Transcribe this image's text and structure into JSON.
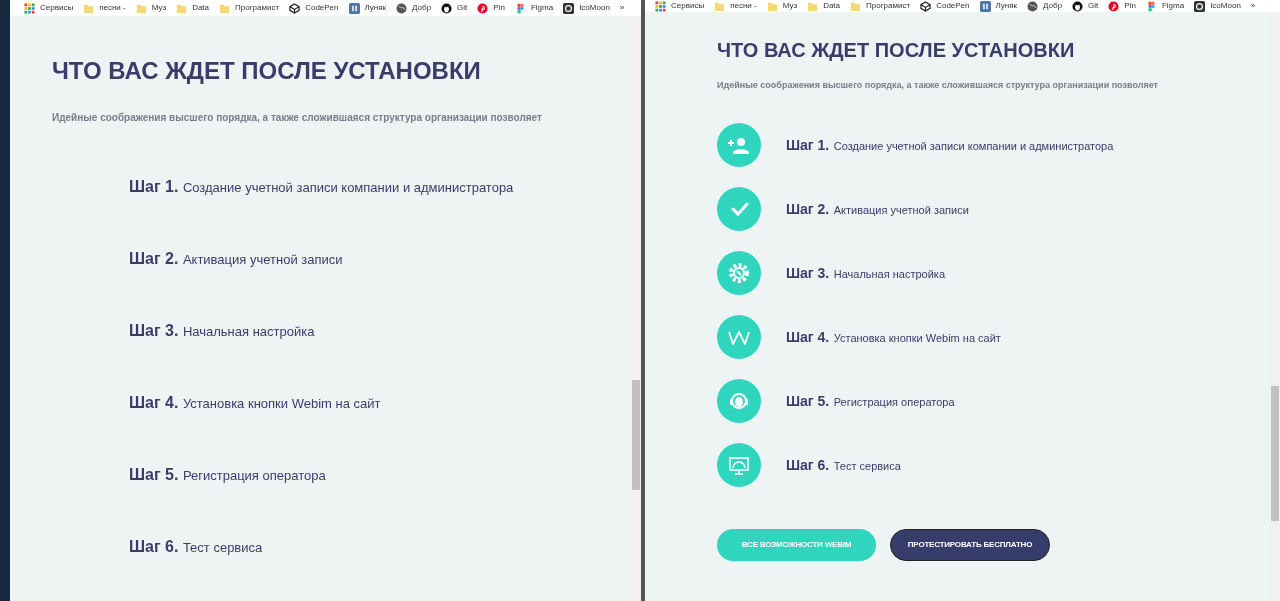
{
  "left_window": {
    "bookmarks": [
      "Сервисы",
      "песни -",
      "Муз",
      "Data",
      "Програмист",
      "CodePen",
      "Луняк",
      "Добр",
      "Git",
      "Pin",
      "Figma",
      "IcoMoon",
      "»"
    ],
    "heading": "ЧТО ВАС ЖДЕТ ПОСЛЕ УСТАНОВКИ",
    "subtitle": "Идейные соображения высшего порядка, а также сложившаяся структура организации позволяет",
    "steps": [
      {
        "label": "Шаг 1.",
        "text": "Создание учетной записи компании и администратора"
      },
      {
        "label": "Шаг 2.",
        "text": "Активация учетной записи"
      },
      {
        "label": "Шаг 3.",
        "text": "Начальная настройка"
      },
      {
        "label": "Шаг 4.",
        "text": "Установка кнопки Webim на сайт"
      },
      {
        "label": "Шаг 5.",
        "text": "Регистрация оператора"
      },
      {
        "label": "Шаг 6.",
        "text": "Тест сервиса"
      }
    ]
  },
  "right_window": {
    "bookmarks": [
      "Сервисы",
      "песни -",
      "Муз",
      "Data",
      "Програмист",
      "CodePen",
      "Луняк",
      "Добр",
      "Git",
      "Pin",
      "Figma",
      "IcoMoon",
      "»"
    ],
    "heading": "ЧТО ВАС ЖДЕТ ПОСЛЕ УСТАНОВКИ",
    "subtitle": "Идейные соображения высшего порядка, а также сложившаяся структура организации позволяет",
    "steps": [
      {
        "label": "Шаг 1.",
        "text": "Создание учетной записи компании и администратора"
      },
      {
        "label": "Шаг 2.",
        "text": "Активация учетной записи"
      },
      {
        "label": "Шаг 3.",
        "text": "Начальная настройка"
      },
      {
        "label": "Шаг 4.",
        "text": "Установка кнопки Webim на сайт"
      },
      {
        "label": "Шаг 5.",
        "text": "Регистрация оператора"
      },
      {
        "label": "Шаг 6.",
        "text": "Тест сервиса"
      }
    ],
    "buttons": [
      "ВСЕ ВОЗМОЖНОСТИ WEBIM",
      "ПРОТЕСТИРОВАТЬ БЕСПЛАТНО"
    ]
  }
}
